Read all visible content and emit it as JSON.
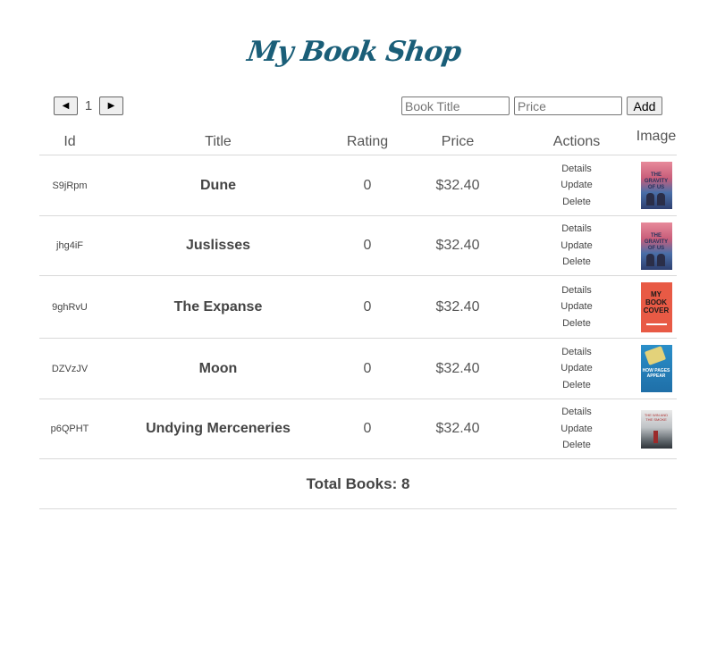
{
  "app": {
    "title": "My Book Shop"
  },
  "pager": {
    "prev_icon": "◀",
    "next_icon": "▶",
    "page": "1"
  },
  "form": {
    "title_placeholder": "Book Title",
    "price_placeholder": "Price",
    "add_label": "Add"
  },
  "table": {
    "headers": {
      "id": "Id",
      "title": "Title",
      "rating": "Rating",
      "price": "Price",
      "actions": "Actions",
      "image": "Image"
    },
    "actions": {
      "details": "Details",
      "update": "Update",
      "delete": "Delete"
    },
    "rows": [
      {
        "id": "S9jRpm",
        "title": "Dune",
        "rating": "0",
        "price": "$32.40",
        "cover": "gravity-cover",
        "cover_text": "THE GRAVITY OF US"
      },
      {
        "id": "jhg4iF",
        "title": "Juslisses",
        "rating": "0",
        "price": "$32.40",
        "cover": "gravity-cover",
        "cover_text": "THE GRAVITY OF US"
      },
      {
        "id": "9ghRvU",
        "title": "The Expanse",
        "rating": "0",
        "price": "$32.40",
        "cover": "my-book-cover",
        "cover_text": "MY BOOK COVER"
      },
      {
        "id": "DZVzJV",
        "title": "Moon",
        "rating": "0",
        "price": "$32.40",
        "cover": "moon-cover",
        "cover_text": "HOW PAGES APPEAR"
      },
      {
        "id": "p6QPHT",
        "title": "Undying Merceneries",
        "rating": "0",
        "price": "$32.40",
        "cover": "wilderness-cover",
        "cover_text": "THE WIN AND THE SMOKE"
      }
    ]
  },
  "footer": {
    "total": "Total Books: 8"
  },
  "colors": {
    "title": "#1a5e78",
    "text": "#444444",
    "rule": "#d9d9d9"
  }
}
